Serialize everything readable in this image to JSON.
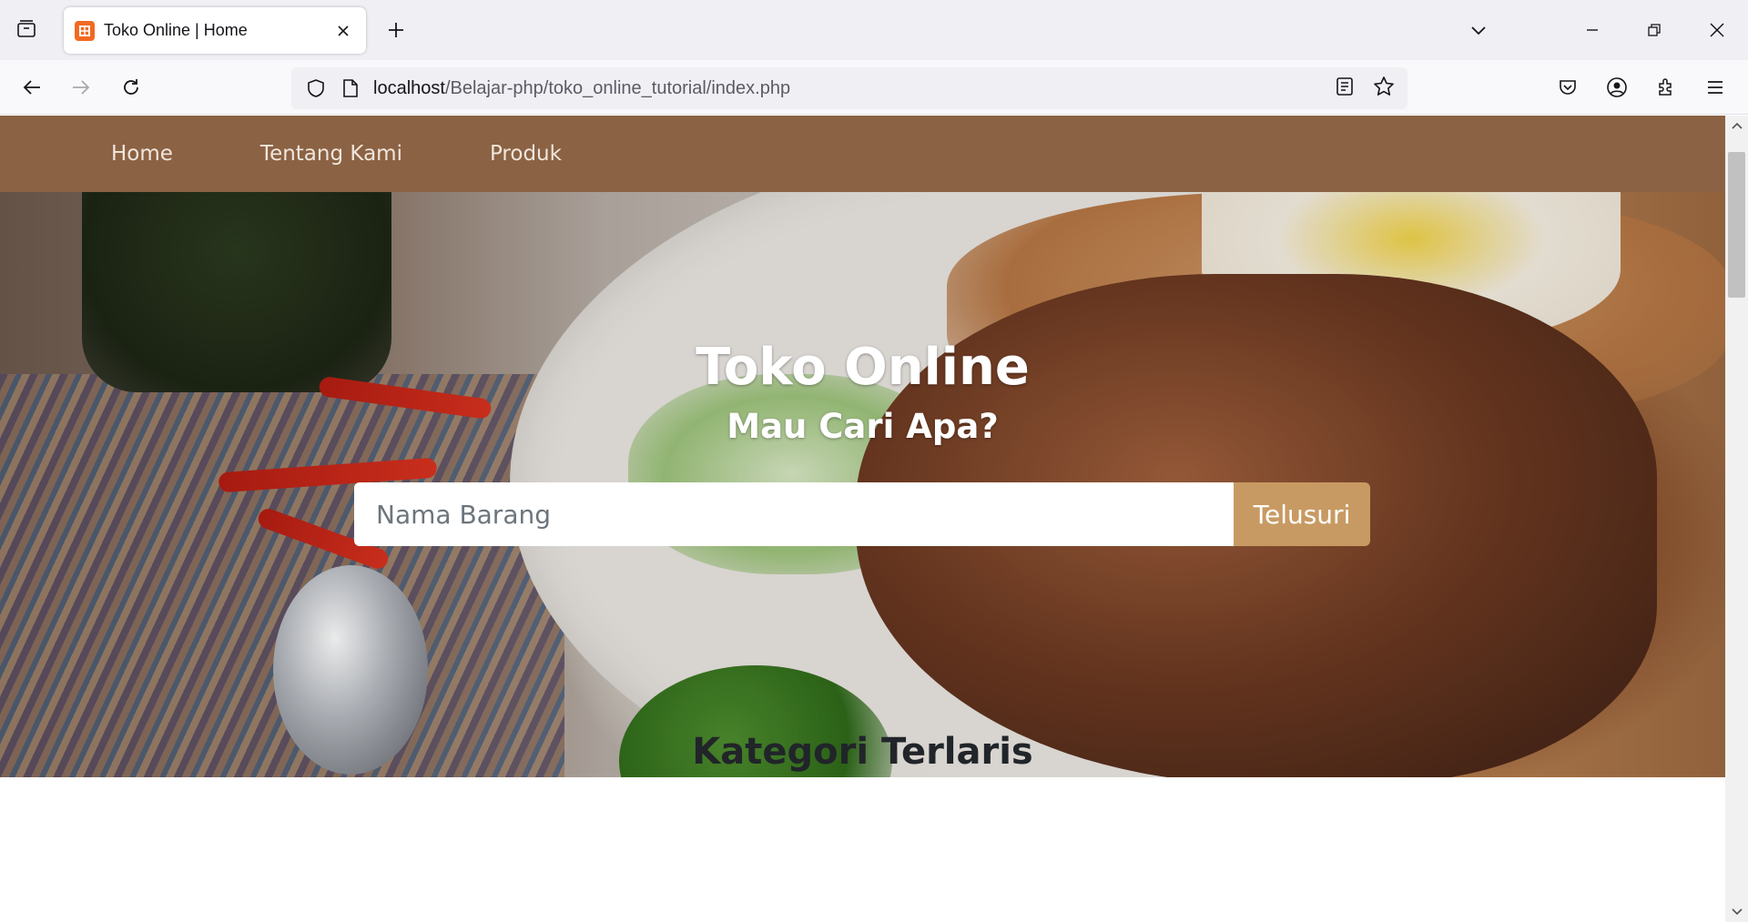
{
  "browser": {
    "tab": {
      "title": "Toko Online | Home"
    },
    "url": {
      "host": "localhost",
      "path": "/Belajar-php/toko_online_tutorial/index.php"
    }
  },
  "site": {
    "nav": {
      "items": [
        "Home",
        "Tentang Kami",
        "Produk"
      ]
    },
    "hero": {
      "title": "Toko Online",
      "subtitle": "Mau Cari Apa?",
      "search_placeholder": "Nama Barang",
      "search_button": "Telusuri"
    },
    "section_title": "Kategori Terlaris"
  },
  "colors": {
    "nav_bg": "#8b6244",
    "button_bg": "#c89a63",
    "favicon": "#f26922"
  }
}
